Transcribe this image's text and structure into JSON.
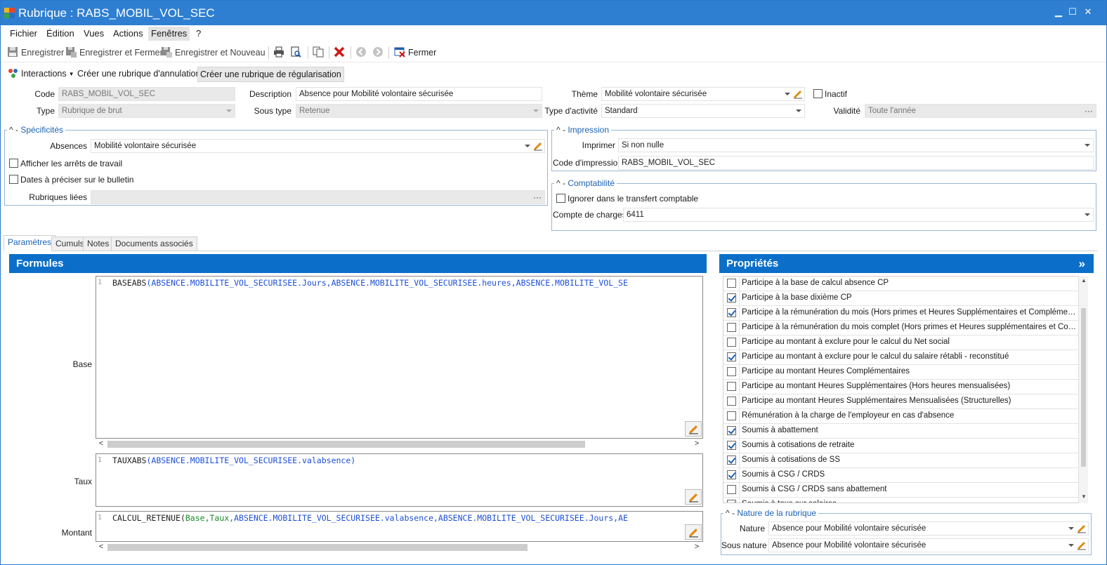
{
  "window": {
    "title": "Rubrique : RABS_MOBIL_VOL_SEC",
    "min_glyph": "▁",
    "max_glyph": "☐",
    "close_glyph": "✕"
  },
  "menu": [
    "Fichier",
    "Édition",
    "Vues",
    "Actions",
    "Fenêtres",
    "?"
  ],
  "toolbar": {
    "save": "Enregistrer",
    "save_close": "Enregistrer et Fermer",
    "save_new": "Enregistrer et Nouveau",
    "close": "Fermer"
  },
  "toolbar2": {
    "interactions": "Interactions",
    "cancel_rubric": "Créer une rubrique d'annulation",
    "regul_rubric": "Créer une rubrique de régularisation"
  },
  "form": {
    "code_label": "Code",
    "code_value": "RABS_MOBIL_VOL_SEC",
    "type_label": "Type",
    "type_value": "Rubrique de brut",
    "description_label": "Description",
    "description_value": "Absence pour Mobilité volontaire sécurisée",
    "soustype_label": "Sous type",
    "soustype_value": "Retenue",
    "theme_label": "Thème",
    "theme_value": "Mobilité volontaire sécurisée",
    "activity_label": "Type d'activité",
    "activity_value": "Standard",
    "inactif_label": "Inactif",
    "validite_label": "Validité",
    "validite_value": "Toute l'année",
    "ellipsis": "···"
  },
  "specificites": {
    "header": "Spécificités",
    "collapse_glyph": "^ -",
    "absences_label": "Absences",
    "absences_value": "Mobilité volontaire sécurisée",
    "arrets_label": "Afficher les arrêts de travail",
    "dates_label": "Dates à préciser sur le bulletin",
    "liees_label": "Rubriques liées"
  },
  "impression": {
    "header": "Impression",
    "imprimer_label": "Imprimer",
    "imprimer_value": "Si non nulle",
    "code_label": "Code d'impression",
    "code_value": "RABS_MOBIL_VOL_SEC"
  },
  "comptabilite": {
    "header": "Comptabilité",
    "ignorer_label": "Ignorer dans le transfert comptable",
    "charges_label": "Compte de charges",
    "charges_value": "6411"
  },
  "tabs": [
    "Paramètres",
    "Cumuls",
    "Notes",
    "Documents associés"
  ],
  "formules": {
    "header": "Formules",
    "line_no": "1",
    "base_label": "Base",
    "base_fn": "BASEABS",
    "base_args": "(ABSENCE.MOBILITE_VOL_SECURISEE.Jours,ABSENCE.MOBILITE_VOL_SECURISEE.heures,ABSENCE.MOBILITE_VOL_SE",
    "taux_label": "Taux",
    "taux_fn": "TAUXABS",
    "taux_args": "(ABSENCE.MOBILITE_VOL_SECURISEE.valabsence)",
    "montant_label": "Montant",
    "montant_fn": "CALCUL_RETENUE",
    "montant_open": "(",
    "montant_kw": "Base,Taux,",
    "montant_args": "ABSENCE.MOBILITE_VOL_SECURISEE.valabsence,ABSENCE.MOBILITE_VOL_SECURISEE.Jours,AE",
    "arrow_left": "<",
    "arrow_right": ">"
  },
  "proprietes": {
    "header": "Propriétés",
    "expand_glyph": "»",
    "items": [
      {
        "label": "Participe à la base de calcul absence CP",
        "checked": false
      },
      {
        "label": "Participe à la base dixième CP",
        "checked": true
      },
      {
        "label": "Participe à la rémunération du mois (Hors primes et Heures Supplémentaires et Complémentaires)",
        "checked": true
      },
      {
        "label": "Participe à la rémunération du mois complet (Hors primes et Heures supplémentaires et Compléme...",
        "checked": false
      },
      {
        "label": "Participe au montant à exclure pour le calcul du Net social",
        "checked": false
      },
      {
        "label": "Participe au montant à exclure pour le calcul du salaire rétabli - reconstitué",
        "checked": true
      },
      {
        "label": "Participe au montant Heures Complémentaires",
        "checked": false
      },
      {
        "label": "Participe au montant Heures Supplémentaires (Hors heures mensualisées)",
        "checked": false
      },
      {
        "label": "Participe au montant Heures Supplémentaires Mensualisées (Structurelles)",
        "checked": false
      },
      {
        "label": "Rémunération à la charge de l'employeur en cas d'absence",
        "checked": false
      },
      {
        "label": "Soumis à abattement",
        "checked": true
      },
      {
        "label": "Soumis à cotisations de retraite",
        "checked": true
      },
      {
        "label": "Soumis à cotisations de SS",
        "checked": true
      },
      {
        "label": "Soumis à CSG / CRDS",
        "checked": true
      },
      {
        "label": "Soumis à CSG / CRDS sans abattement",
        "checked": false
      },
      {
        "label": "Soumis à taxe sur salaires",
        "checked": true
      }
    ]
  },
  "nature": {
    "header": "Nature de la rubrique",
    "nature_label": "Nature",
    "nature_value": "Absence pour Mobilité volontaire sécurisée",
    "sousnature_label": "Sous nature",
    "sousnature_value": "Absence pour Mobilité volontaire sécurisée"
  },
  "colors": {
    "accent": "#0b6fc9",
    "titlebar": "#2e7fd1",
    "code_arg": "#1d4fd6",
    "code_kw": "#1a8a2a"
  }
}
